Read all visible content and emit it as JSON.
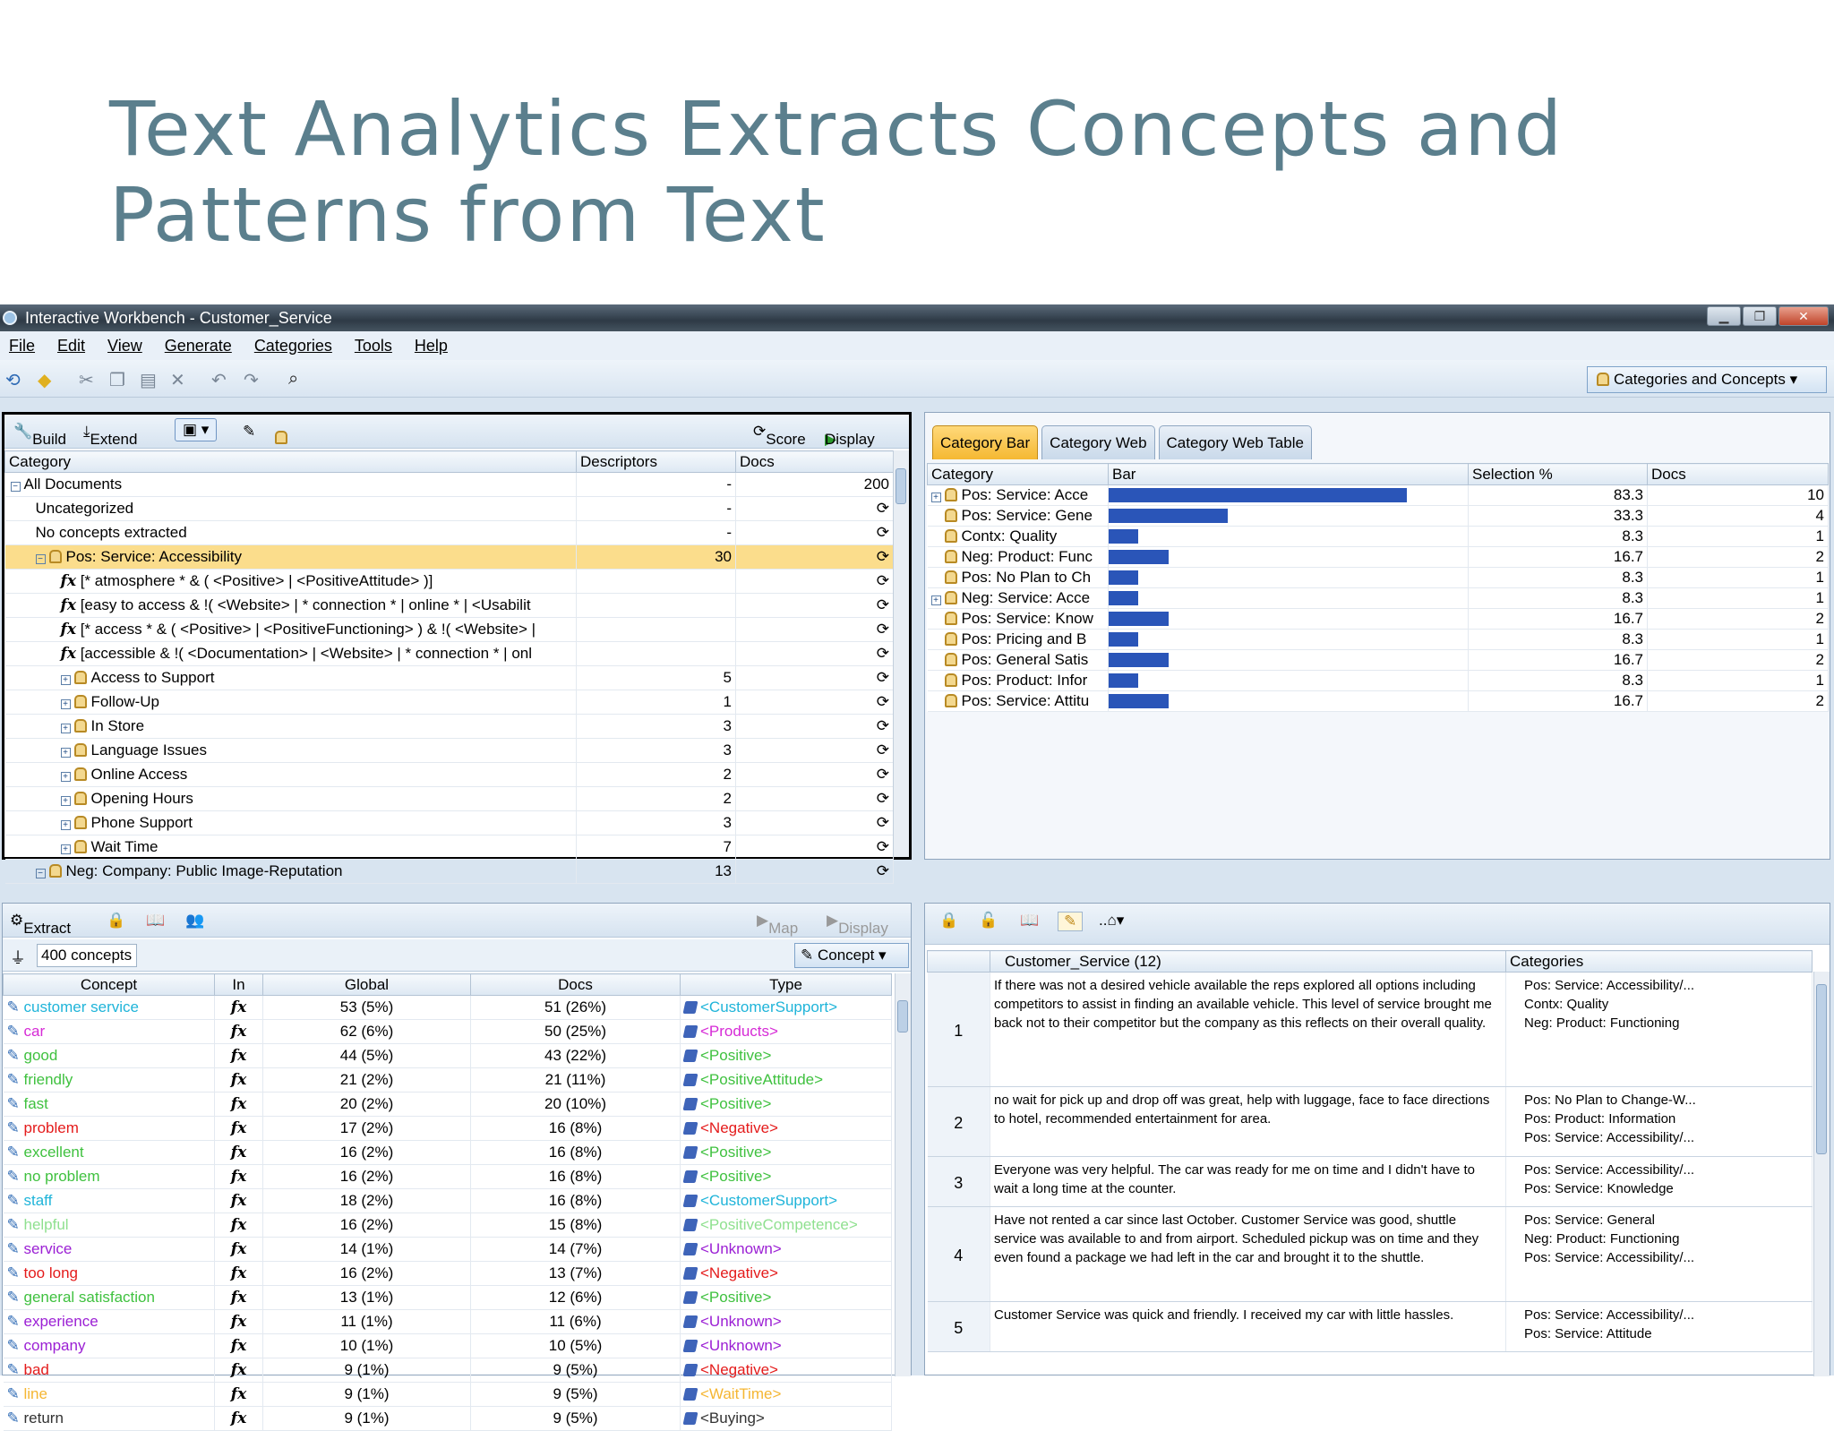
{
  "slide": {
    "title": "Text Analytics Extracts Concepts and Patterns from Text"
  },
  "window": {
    "title": "Interactive Workbench - Customer_Service"
  },
  "menu": [
    "File",
    "Edit",
    "View",
    "Generate",
    "Categories",
    "Tools",
    "Help"
  ],
  "view_select": "Categories and Concepts",
  "categories_panel": {
    "build": "Build",
    "extend": "Extend",
    "score": "Score",
    "display": "Display",
    "headers": [
      "Category",
      "Descriptors",
      "Docs"
    ],
    "rows": [
      {
        "label": "All Documents",
        "desc": "-",
        "docs": "200"
      },
      {
        "label": "Uncategorized",
        "desc": "-",
        "docs": ""
      },
      {
        "label": "No concepts extracted",
        "desc": "-",
        "docs": ""
      },
      {
        "label": "Pos: Service: Accessibility",
        "desc": "30",
        "docs": ""
      },
      {
        "label": "[* atmosphere * & ( <Positive> |  <PositiveAttitude> )]",
        "desc": "",
        "docs": ""
      },
      {
        "label": "[easy to access & !( <Website> | * connection * | online * |  <Usabilit",
        "desc": "",
        "docs": ""
      },
      {
        "label": "[* access * & ( <Positive> |  <PositiveFunctioning> ) & !( <Website> |",
        "desc": "",
        "docs": ""
      },
      {
        "label": "[accessible & !( <Documentation> |  <Website> | * connection * | onl",
        "desc": "",
        "docs": ""
      },
      {
        "label": "Access to Support",
        "desc": "5",
        "docs": ""
      },
      {
        "label": "Follow-Up",
        "desc": "1",
        "docs": ""
      },
      {
        "label": "In Store",
        "desc": "3",
        "docs": ""
      },
      {
        "label": "Language Issues",
        "desc": "3",
        "docs": ""
      },
      {
        "label": "Online Access",
        "desc": "2",
        "docs": ""
      },
      {
        "label": "Opening Hours",
        "desc": "2",
        "docs": ""
      },
      {
        "label": "Phone Support",
        "desc": "3",
        "docs": ""
      },
      {
        "label": "Wait Time",
        "desc": "7",
        "docs": ""
      },
      {
        "label": "Neg: Company: Public Image-Reputation",
        "desc": "13",
        "docs": ""
      }
    ]
  },
  "chart_panel": {
    "tabs": [
      "Category Bar",
      "Category Web",
      "Category Web Table"
    ],
    "headers": [
      "Category",
      "Bar",
      "Selection %",
      "Docs"
    ]
  },
  "chart_data": {
    "type": "bar",
    "categories": [
      "Pos: Service: Acce",
      "Pos: Service: Gene",
      "Contx: Quality",
      "Neg: Product: Func",
      "Pos: No Plan to Ch",
      "Neg: Service: Acce",
      "Pos: Service: Know",
      "Pos: Pricing and B",
      "Pos: General Satis",
      "Pos: Product: Infor",
      "Pos: Service: Attitu"
    ],
    "values": [
      83.3,
      33.3,
      8.3,
      16.7,
      8.3,
      8.3,
      16.7,
      8.3,
      16.7,
      8.3,
      16.7
    ],
    "docs": [
      10,
      4,
      1,
      2,
      1,
      1,
      2,
      1,
      2,
      1,
      2
    ],
    "xlabel": "",
    "ylabel": "Selection %",
    "color": "#2a55b8"
  },
  "concepts_panel": {
    "extract": "Extract",
    "map": "Map",
    "display": "Display",
    "filter": "400 concepts",
    "concept_select": "Concept",
    "headers": [
      "Concept",
      "In",
      "Global",
      "Docs",
      "Type"
    ],
    "rows": [
      {
        "c": "customer service",
        "g": "53 (5%)",
        "d": "51 (26%)",
        "t": "<CustomerSupport>",
        "color": "#1fb4d9"
      },
      {
        "c": "car",
        "g": "62 (6%)",
        "d": "50 (25%)",
        "t": "<Products>",
        "color": "#d62ad6"
      },
      {
        "c": "good",
        "g": "44 (5%)",
        "d": "43 (22%)",
        "t": "<Positive>",
        "color": "#3fc13f"
      },
      {
        "c": "friendly",
        "g": "21 (2%)",
        "d": "21 (11%)",
        "t": "<PositiveAttitude>",
        "color": "#3fc13f"
      },
      {
        "c": "fast",
        "g": "20 (2%)",
        "d": "20 (10%)",
        "t": "<Positive>",
        "color": "#3fc13f"
      },
      {
        "c": "problem",
        "g": "17 (2%)",
        "d": "16 (8%)",
        "t": "<Negative>",
        "color": "#e41b1b"
      },
      {
        "c": "excellent",
        "g": "16 (2%)",
        "d": "16 (8%)",
        "t": "<Positive>",
        "color": "#3fc13f"
      },
      {
        "c": "no problem",
        "g": "16 (2%)",
        "d": "16 (8%)",
        "t": "<Positive>",
        "color": "#3fc13f"
      },
      {
        "c": "staff",
        "g": "18 (2%)",
        "d": "16 (8%)",
        "t": "<CustomerSupport>",
        "color": "#1fb4d9"
      },
      {
        "c": "helpful",
        "g": "16 (2%)",
        "d": "15 (8%)",
        "t": "<PositiveCompetence>",
        "color": "#8fe08f"
      },
      {
        "c": "service",
        "g": "14 (1%)",
        "d": "14 (7%)",
        "t": "<Unknown>",
        "color": "#9b1fd4"
      },
      {
        "c": "too long",
        "g": "16 (2%)",
        "d": "13 (7%)",
        "t": "<Negative>",
        "color": "#e41b1b"
      },
      {
        "c": "general satisfaction",
        "g": "13 (1%)",
        "d": "12 (6%)",
        "t": "<Positive>",
        "color": "#3fc13f"
      },
      {
        "c": "experience",
        "g": "11 (1%)",
        "d": "11 (6%)",
        "t": "<Unknown>",
        "color": "#9b1fd4"
      },
      {
        "c": "company",
        "g": "10 (1%)",
        "d": "10 (5%)",
        "t": "<Unknown>",
        "color": "#9b1fd4"
      },
      {
        "c": "bad",
        "g": "9 (1%)",
        "d": "9 (5%)",
        "t": "<Negative>",
        "color": "#e41b1b"
      },
      {
        "c": "line",
        "g": "9 (1%)",
        "d": "9 (5%)",
        "t": "<WaitTime>",
        "color": "#f5b632"
      },
      {
        "c": "return",
        "g": "9 (1%)",
        "d": "9 (5%)",
        "t": "<Buying>",
        "color": "#333333"
      }
    ]
  },
  "docs_panel": {
    "headers": [
      "Customer_Service (12)",
      "Categories"
    ],
    "rows": [
      {
        "idx": "1",
        "text": "If there was not a desired vehicle available the reps explored all options including competitors to assist in finding an available vehicle. This level of service brought me back not to their competitor but the company as this reflects on their overall quality.",
        "cats": [
          "Pos: Service: Accessibility/...",
          "Contx: Quality",
          "Neg: Product: Functioning"
        ]
      },
      {
        "idx": "2",
        "text": "no wait for pick up and drop off was great, help with luggage, face to face directions to hotel, recommended entertainment for area.",
        "cats": [
          "Pos: No Plan to Change-W...",
          "Pos: Product: Information",
          "Pos: Service: Accessibility/..."
        ]
      },
      {
        "idx": "3",
        "text": "Everyone was very helpful. The car was ready for me on time and I didn't have to wait a long time at the counter.",
        "cats": [
          "Pos: Service: Accessibility/...",
          "Pos: Service: Knowledge"
        ]
      },
      {
        "idx": "4",
        "text": "Have not rented a car since last October. Customer Service was good, shuttle service was available to and from airport. Scheduled pickup was on time and they even found a package we had left in the car and brought it to the shuttle.",
        "cats": [
          "Pos: Service: General",
          "Neg: Product: Functioning",
          "Pos: Service: Accessibility/..."
        ]
      },
      {
        "idx": "5",
        "text": "Customer Service was quick and friendly. I received my car with little hassles.",
        "cats": [
          "Pos: Service: Accessibility/...",
          "Pos: Service: Attitude"
        ]
      }
    ]
  }
}
